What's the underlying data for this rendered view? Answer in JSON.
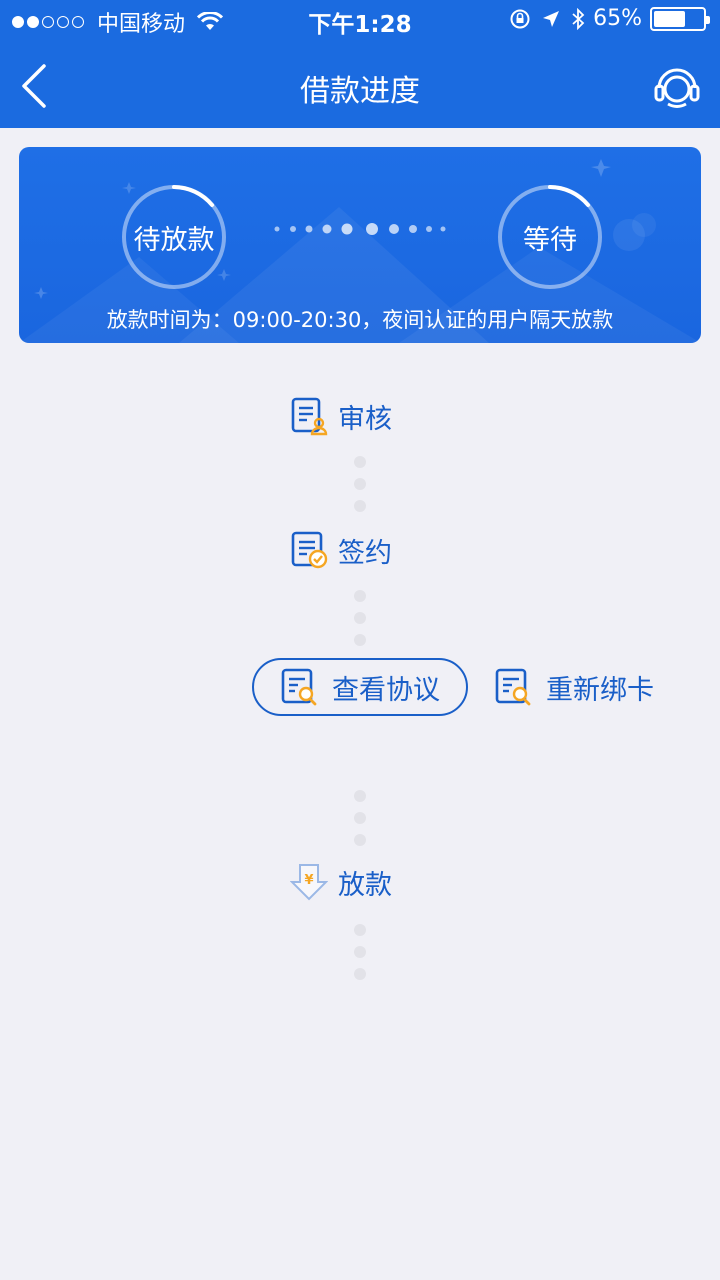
{
  "statusbar": {
    "carrier": "中国移动",
    "time": "下午1:28",
    "battery_pct_text": "65%",
    "battery_level": 0.65
  },
  "nav": {
    "title": "借款进度"
  },
  "status_card": {
    "left_circle_label": "待放款",
    "right_circle_label": "等待",
    "note": "放款时间为：09:00-20:30，夜间认证的用户隔天放款"
  },
  "steps": {
    "review": "审核",
    "sign": "签约",
    "view_agreement": "查看协议",
    "rebind_card": "重新绑卡",
    "disburse": "放款"
  },
  "colors": {
    "primary": "#1b6be0",
    "accent": "#f5a623",
    "text_blue": "#1a5fc8"
  }
}
